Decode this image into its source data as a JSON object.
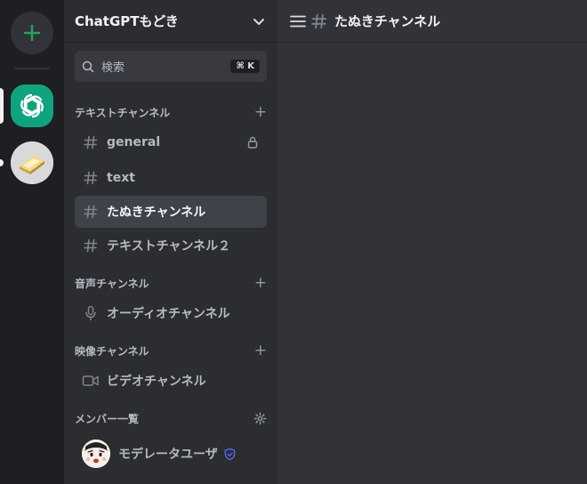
{
  "server": {
    "name": "ChatGPTもどき"
  },
  "search": {
    "placeholder": "検索",
    "shortcut": "⌘ K"
  },
  "categories": [
    {
      "label": "テキストチャンネル",
      "channels": [
        {
          "name": "general",
          "icon": "hash-icon",
          "locked": true
        },
        {
          "name": "text",
          "icon": "hash-icon"
        },
        {
          "name": "たぬきチャンネル",
          "icon": "hash-icon",
          "active": true
        },
        {
          "name": "テキストチャンネル２",
          "icon": "hash-icon"
        }
      ]
    },
    {
      "label": "音声チャンネル",
      "channels": [
        {
          "name": "オーディオチャンネル",
          "icon": "microphone-icon"
        }
      ]
    },
    {
      "label": "映像チャンネル",
      "channels": [
        {
          "name": "ビデオチャンネル",
          "icon": "video-camera-icon"
        }
      ]
    }
  ],
  "members_section": {
    "label": "メンバー一覧",
    "members": [
      {
        "name": "モデレータユーザ",
        "badge": "shield-icon"
      }
    ]
  },
  "main": {
    "channel_title": "たぬきチャンネル"
  },
  "colors": {
    "accent_green": "#23a55a",
    "gpt_brand": "#10a37f",
    "moderator_badge": "#5865f2"
  }
}
